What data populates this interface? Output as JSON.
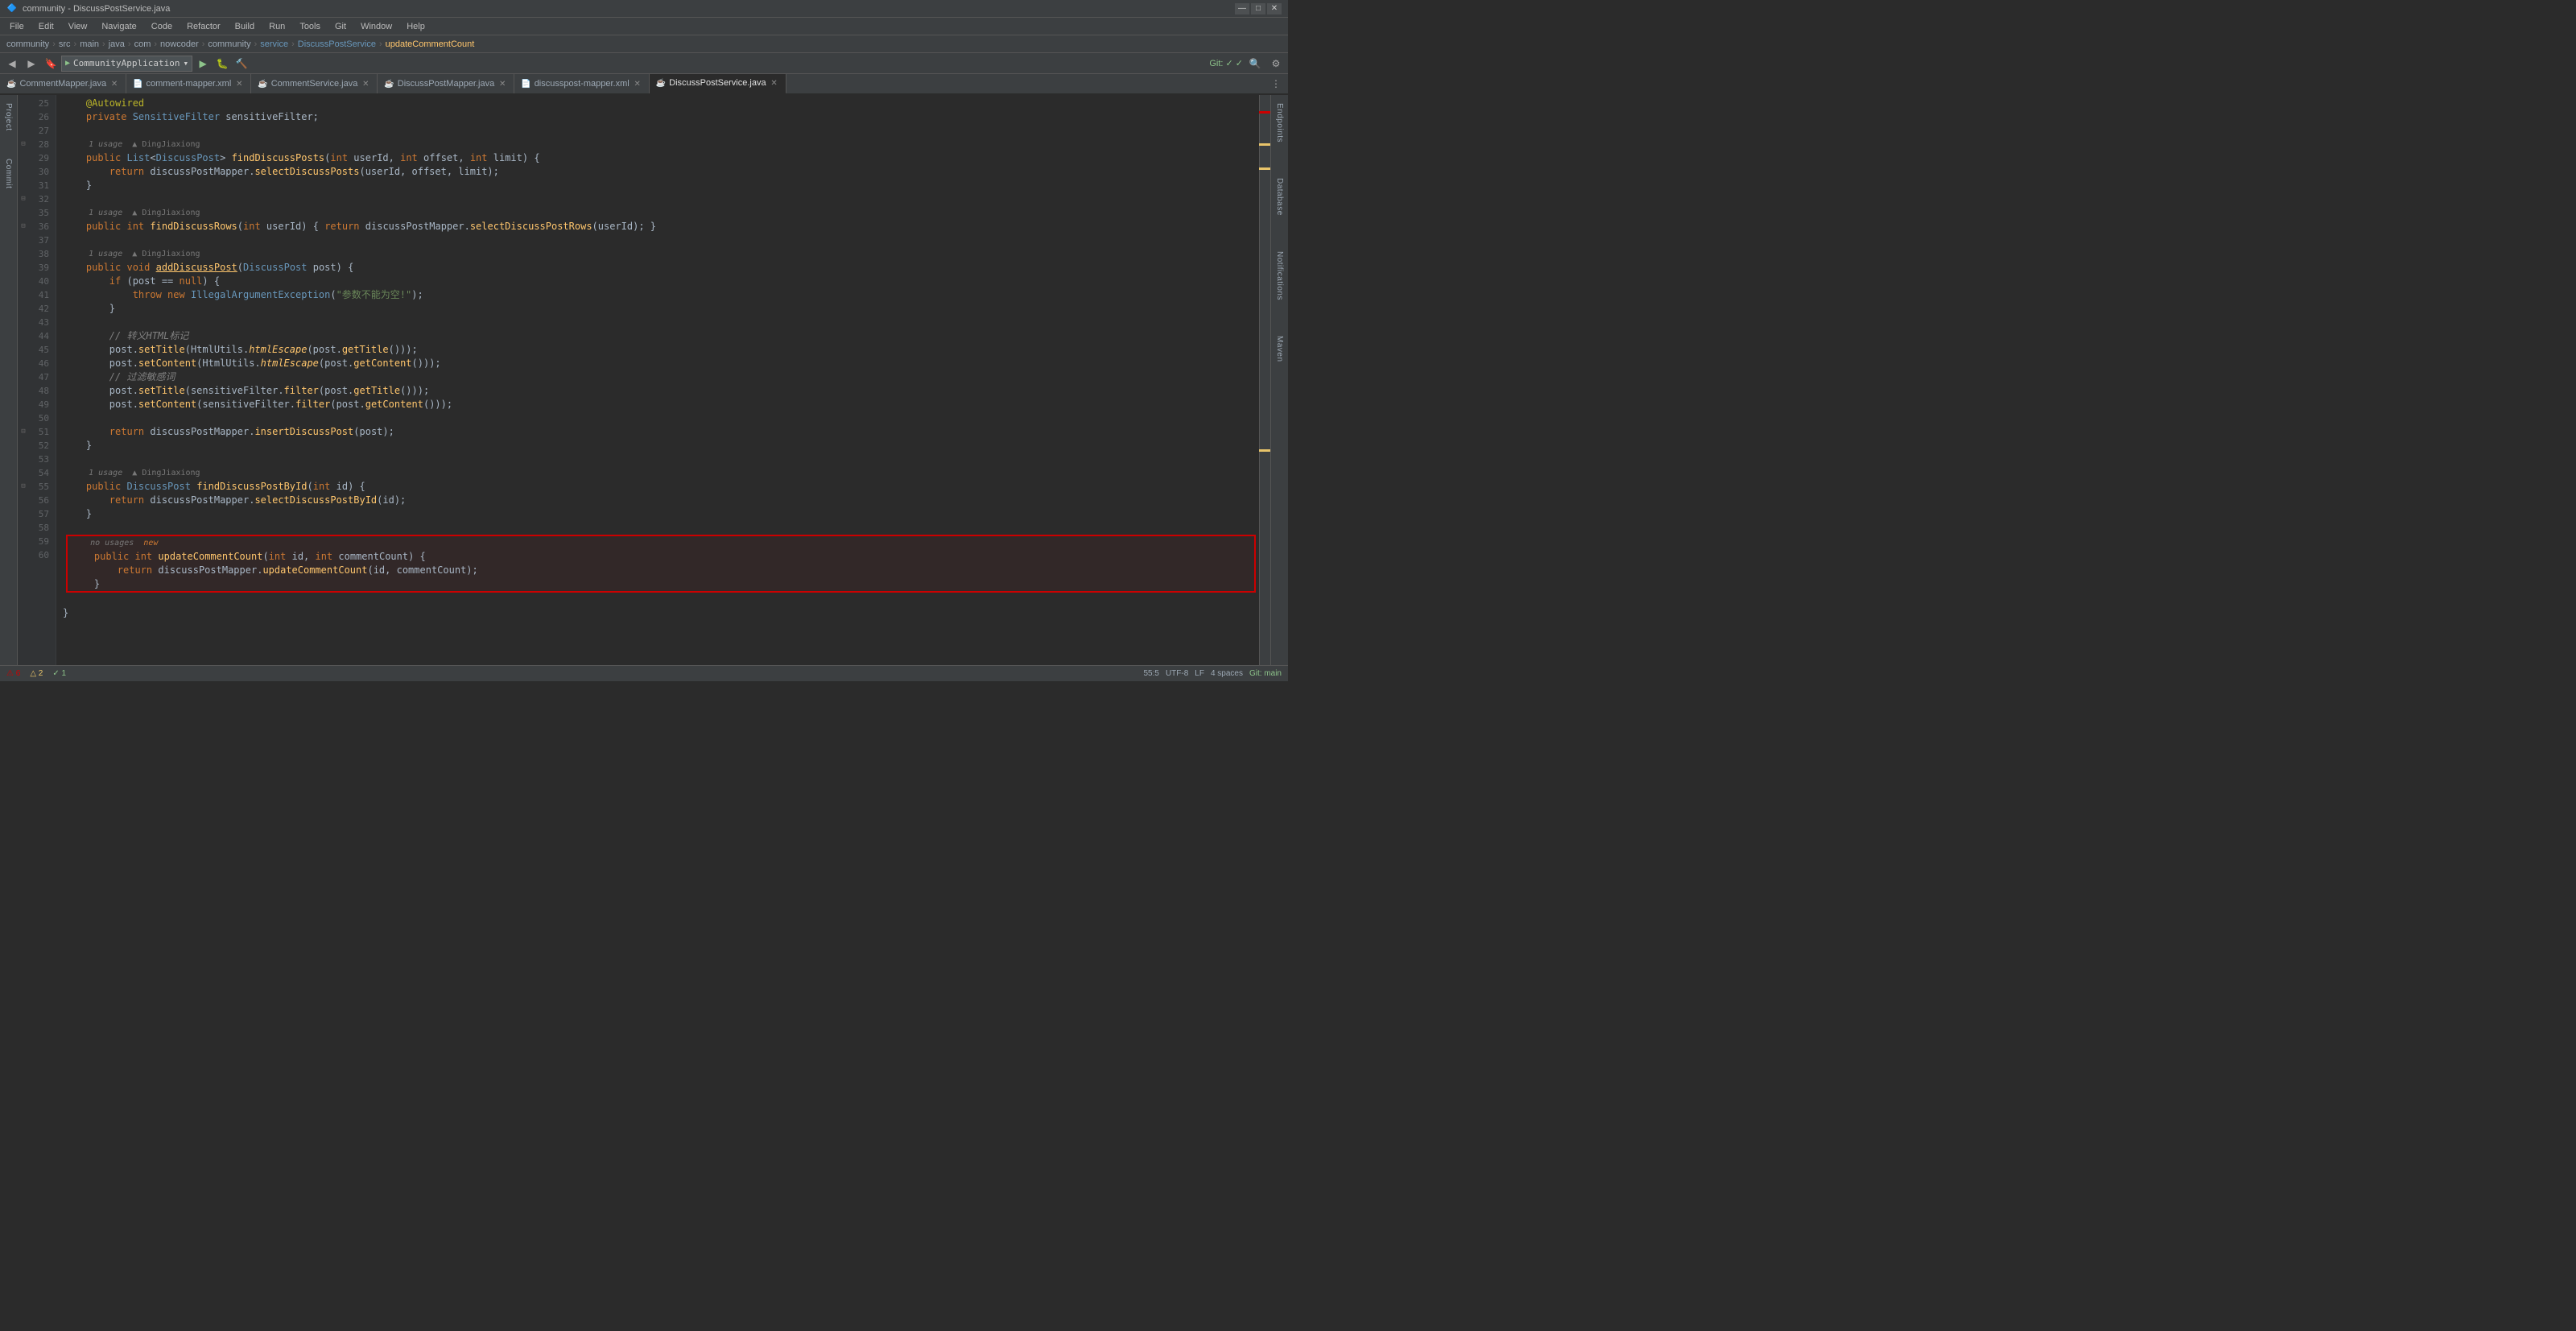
{
  "window": {
    "title": "community - DiscussPostService.java",
    "min_btn": "—",
    "max_btn": "□",
    "close_btn": "✕"
  },
  "menu": {
    "items": [
      "File",
      "Edit",
      "View",
      "Navigate",
      "Code",
      "Refactor",
      "Build",
      "Run",
      "Tools",
      "Git",
      "Window",
      "Help"
    ]
  },
  "breadcrumbs": {
    "project": "community",
    "src": "src",
    "main": "main",
    "java": "java",
    "com": "com",
    "nowcoder": "nowcoder",
    "community2": "community",
    "service": "service",
    "file": "DiscussPostService",
    "method": "updateCommentCount"
  },
  "toolbar": {
    "app_dropdown": "CommunityApplication",
    "git_checks": "Git: ✓ ✓"
  },
  "tabs": [
    {
      "label": "CommentMapper.java",
      "type": "java",
      "active": false
    },
    {
      "label": "comment-mapper.xml",
      "type": "xml",
      "active": false
    },
    {
      "label": "CommentService.java",
      "type": "java",
      "active": false
    },
    {
      "label": "DiscussPostMapper.java",
      "type": "java",
      "active": false
    },
    {
      "label": "discusspost-mapper.xml",
      "type": "xml",
      "active": false
    },
    {
      "label": "DiscussPostService.java",
      "type": "java",
      "active": true
    }
  ],
  "code": {
    "lines": [
      {
        "num": 25,
        "content": "    @Autowired",
        "type": "annotation"
      },
      {
        "num": 26,
        "content": "    private SensitiveFilter sensitiveFilter;",
        "type": "code"
      },
      {
        "num": 27,
        "content": "",
        "type": "empty"
      },
      {
        "num": 28,
        "content": "    public List<DiscussPost> findDiscussPosts(int userId, int offset, int limit) {",
        "type": "code",
        "hint": "1 usage  ▲ DingJiaxiong"
      },
      {
        "num": 29,
        "content": "        return discussPostMapper.selectDiscussPosts(userId, offset, limit);",
        "type": "code"
      },
      {
        "num": 30,
        "content": "    }",
        "type": "code"
      },
      {
        "num": 31,
        "content": "",
        "type": "empty"
      },
      {
        "num": 32,
        "content": "    public int findDiscussRows(int userId) { return discussPostMapper.selectDiscussPostRows(userId); }",
        "type": "code",
        "hint": "1 usage  ▲ DingJiaxiong"
      },
      {
        "num": 35,
        "content": "",
        "type": "empty"
      },
      {
        "num": 36,
        "content": "    public void addDiscussPost(DiscussPost post) {",
        "type": "code",
        "hint": "1 usage  ▲ DingJiaxiong"
      },
      {
        "num": 37,
        "content": "        if (post == null) {",
        "type": "code"
      },
      {
        "num": 38,
        "content": "            throw new IllegalArgumentException(\"参数不能为空!\");",
        "type": "code"
      },
      {
        "num": 39,
        "content": "        }",
        "type": "code"
      },
      {
        "num": 40,
        "content": "",
        "type": "empty"
      },
      {
        "num": 41,
        "content": "        // 转义HTML标记",
        "type": "comment"
      },
      {
        "num": 42,
        "content": "        post.setTitle(HtmlUtils.htmlEscape(post.getTitle()));",
        "type": "code"
      },
      {
        "num": 43,
        "content": "        post.setContent(HtmlUtils.htmlEscape(post.getContent()));",
        "type": "code"
      },
      {
        "num": 44,
        "content": "        // 过滤敏感词",
        "type": "comment"
      },
      {
        "num": 45,
        "content": "        post.setTitle(sensitiveFilter.filter(post.getTitle()));",
        "type": "code"
      },
      {
        "num": 46,
        "content": "        post.setContent(sensitiveFilter.filter(post.getContent()));",
        "type": "code"
      },
      {
        "num": 47,
        "content": "",
        "type": "empty"
      },
      {
        "num": 48,
        "content": "        return discussPostMapper.insertDiscussPost(post);",
        "type": "code"
      },
      {
        "num": 49,
        "content": "    }",
        "type": "code"
      },
      {
        "num": 50,
        "content": "",
        "type": "empty"
      },
      {
        "num": 51,
        "content": "    public DiscussPost findDiscussPostById(int id) {",
        "type": "code",
        "hint": "1 usage  ▲ DingJiaxiong"
      },
      {
        "num": 52,
        "content": "        return discussPostMapper.selectDiscussPostById(id);",
        "type": "code"
      },
      {
        "num": 53,
        "content": "    }",
        "type": "code"
      },
      {
        "num": 54,
        "content": "",
        "type": "empty"
      },
      {
        "num": 55,
        "content": "    public int updateCommentCount(int id, int commentCount) {",
        "type": "highlighted",
        "hint": "no usages  new"
      },
      {
        "num": 56,
        "content": "        return discussPostMapper.updateCommentCount(id, commentCount);",
        "type": "highlighted"
      },
      {
        "num": 57,
        "content": "    }",
        "type": "highlighted"
      },
      {
        "num": 58,
        "content": "",
        "type": "empty"
      },
      {
        "num": 59,
        "content": "}",
        "type": "code"
      },
      {
        "num": 60,
        "content": "",
        "type": "empty"
      }
    ]
  },
  "status": {
    "line_col": "55:5",
    "encoding": "UTF-8",
    "line_sep": "LF",
    "indent": "4 spaces",
    "git_branch": "Git: main",
    "warnings": "⚠ 6  △ 2  ✓ 1"
  },
  "side_panels": {
    "right": [
      "Endpoints",
      "Database",
      "Notifications",
      "Maven"
    ]
  }
}
